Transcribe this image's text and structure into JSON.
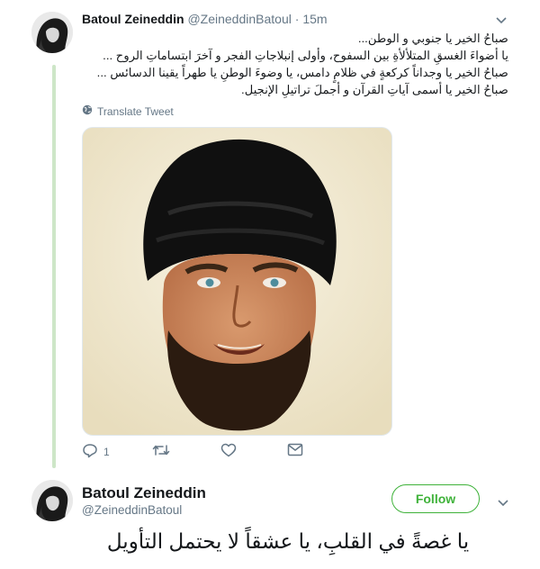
{
  "tweet1": {
    "display_name": "Batoul Zeineddin",
    "handle": "@ZeineddinBatoul",
    "separator": "·",
    "time": "15m",
    "text_lines": [
      "صباحُ الخير يا جنوبي و الوطن...",
      "يا أضواءَ الغسقِ المتلألأةِ بين السفوح، وأولى إنبلاجاتِ الفجر و آخرَ ابتساماتِ الروح ...",
      "صباحُ الخير يا وجداناً كركعةٍ في ظلامٍ دامس، يا وضوءَ الوطنِ يا طهراً يقينا الدسائس ...",
      "صباحُ الخير يا أسمى آياتِ القرآن و أجملَ تراتيلِ الإنجيل."
    ],
    "translate_label": "Translate Tweet",
    "reply_count": "1",
    "retweet_count": "",
    "like_count": ""
  },
  "tweet2": {
    "display_name": "Batoul Zeineddin",
    "handle": "@ZeineddinBatoul",
    "follow_label": "Follow",
    "text": "يا غصةً في القلبِ، يا عشقاً لا يحتمل التأويل"
  },
  "colors": {
    "thread_line": "#cde6c7",
    "follow_accent": "#3fb23a",
    "muted": "#657786",
    "text": "#14171a"
  },
  "icons": [
    "caret-down-icon",
    "globe-icon",
    "reply-icon",
    "retweet-icon",
    "heart-icon",
    "message-icon"
  ]
}
